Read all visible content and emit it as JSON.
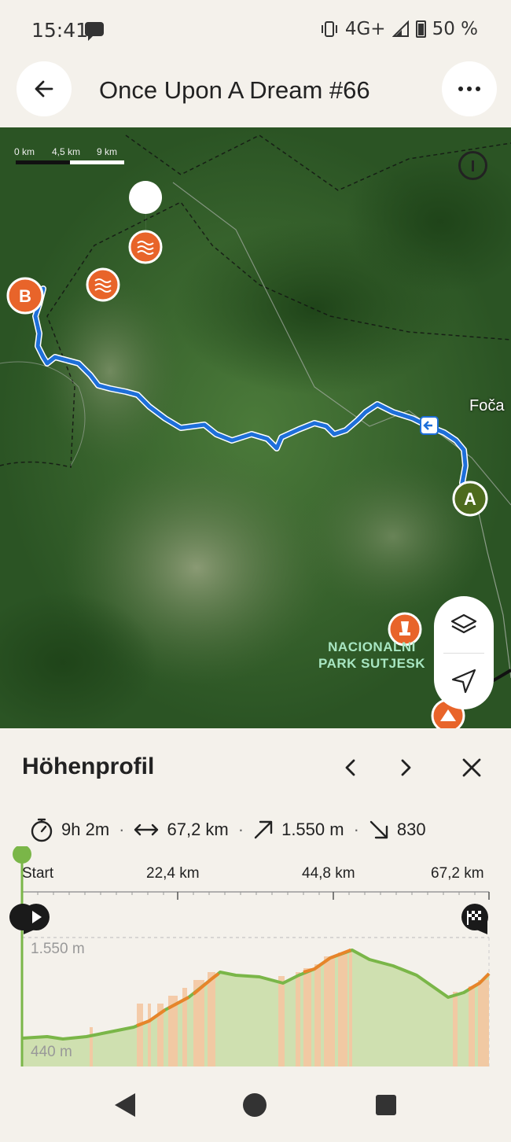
{
  "status": {
    "time": "15:41",
    "network": "4G+",
    "battery": "50 %"
  },
  "header": {
    "title": "Once Upon A Dream #66"
  },
  "map": {
    "scale": [
      "0 km",
      "4,5 km",
      "9 km"
    ],
    "town": "Foča",
    "park": [
      "NACIONALNI",
      "PARK SUTJESK"
    ],
    "start_marker": "A",
    "end_marker": "B"
  },
  "panel": {
    "title": "Höhenprofil",
    "stats": {
      "duration": "9h 2m",
      "distance": "67,2 km",
      "ascent": "1.550 m",
      "descent": "830"
    },
    "axis": [
      "Start",
      "22,4 km",
      "44,8 km",
      "67,2 km"
    ],
    "elevation": {
      "max_label": "1.550 m",
      "min_label": "440 m"
    }
  },
  "colors": {
    "route": "#1e6fd9",
    "accent": "#e8642a",
    "profile_fill": "#cfe0b0",
    "profile_line": "#7ab648"
  }
}
